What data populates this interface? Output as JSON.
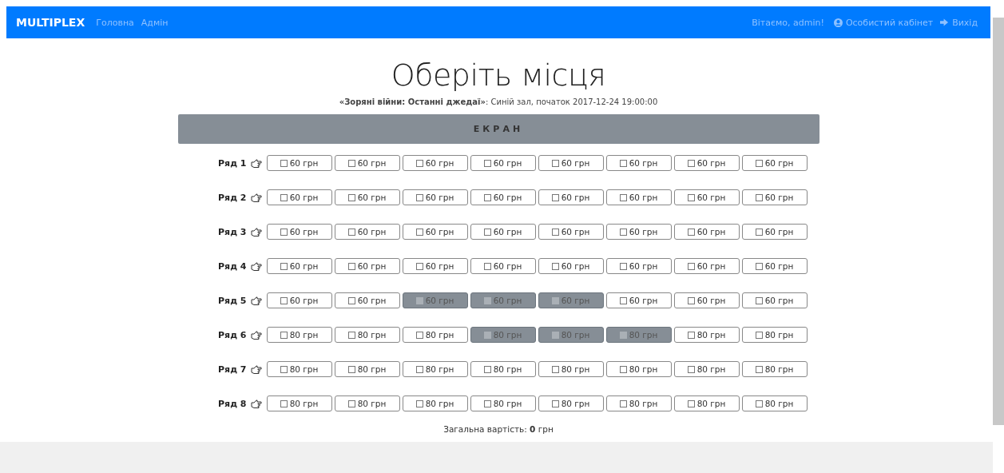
{
  "navbar": {
    "brand": "MULTIPLEX",
    "links": [
      "Головна",
      "Адмін"
    ],
    "greeting": "Вітаємо, admin!",
    "account": "Особистий кабінет",
    "logout": "Вихід"
  },
  "title": "Оберіть місця",
  "subtitle": {
    "film": "«Зоряні війни: Останні джедаї»",
    "details": ": Синій зал, початок 2017-12-24 19:00:00"
  },
  "screen": "ЕКРАН",
  "rows": [
    {
      "label": "Ряд 1",
      "seats": [
        {
          "price": "60 грн",
          "booked": false
        },
        {
          "price": "60 грн",
          "booked": false
        },
        {
          "price": "60 грн",
          "booked": false
        },
        {
          "price": "60 грн",
          "booked": false
        },
        {
          "price": "60 грн",
          "booked": false
        },
        {
          "price": "60 грн",
          "booked": false
        },
        {
          "price": "60 грн",
          "booked": false
        },
        {
          "price": "60 грн",
          "booked": false
        }
      ]
    },
    {
      "label": "Ряд 2",
      "seats": [
        {
          "price": "60 грн",
          "booked": false
        },
        {
          "price": "60 грн",
          "booked": false
        },
        {
          "price": "60 грн",
          "booked": false
        },
        {
          "price": "60 грн",
          "booked": false
        },
        {
          "price": "60 грн",
          "booked": false
        },
        {
          "price": "60 грн",
          "booked": false
        },
        {
          "price": "60 грн",
          "booked": false
        },
        {
          "price": "60 грн",
          "booked": false
        }
      ]
    },
    {
      "label": "Ряд 3",
      "seats": [
        {
          "price": "60 грн",
          "booked": false
        },
        {
          "price": "60 грн",
          "booked": false
        },
        {
          "price": "60 грн",
          "booked": false
        },
        {
          "price": "60 грн",
          "booked": false
        },
        {
          "price": "60 грн",
          "booked": false
        },
        {
          "price": "60 грн",
          "booked": false
        },
        {
          "price": "60 грн",
          "booked": false
        },
        {
          "price": "60 грн",
          "booked": false
        }
      ]
    },
    {
      "label": "Ряд 4",
      "seats": [
        {
          "price": "60 грн",
          "booked": false
        },
        {
          "price": "60 грн",
          "booked": false
        },
        {
          "price": "60 грн",
          "booked": false
        },
        {
          "price": "60 грн",
          "booked": false
        },
        {
          "price": "60 грн",
          "booked": false
        },
        {
          "price": "60 грн",
          "booked": false
        },
        {
          "price": "60 грн",
          "booked": false
        },
        {
          "price": "60 грн",
          "booked": false
        }
      ]
    },
    {
      "label": "Ряд 5",
      "seats": [
        {
          "price": "60 грн",
          "booked": false
        },
        {
          "price": "60 грн",
          "booked": false
        },
        {
          "price": "60 грн",
          "booked": true
        },
        {
          "price": "60 грн",
          "booked": true
        },
        {
          "price": "60 грн",
          "booked": true
        },
        {
          "price": "60 грн",
          "booked": false
        },
        {
          "price": "60 грн",
          "booked": false
        },
        {
          "price": "60 грн",
          "booked": false
        }
      ]
    },
    {
      "label": "Ряд 6",
      "seats": [
        {
          "price": "80 грн",
          "booked": false
        },
        {
          "price": "80 грн",
          "booked": false
        },
        {
          "price": "80 грн",
          "booked": false
        },
        {
          "price": "80 грн",
          "booked": true
        },
        {
          "price": "80 грн",
          "booked": true
        },
        {
          "price": "80 грн",
          "booked": true
        },
        {
          "price": "80 грн",
          "booked": false
        },
        {
          "price": "80 грн",
          "booked": false
        }
      ]
    },
    {
      "label": "Ряд 7",
      "seats": [
        {
          "price": "80 грн",
          "booked": false
        },
        {
          "price": "80 грн",
          "booked": false
        },
        {
          "price": "80 грн",
          "booked": false
        },
        {
          "price": "80 грн",
          "booked": false
        },
        {
          "price": "80 грн",
          "booked": false
        },
        {
          "price": "80 грн",
          "booked": false
        },
        {
          "price": "80 грн",
          "booked": false
        },
        {
          "price": "80 грн",
          "booked": false
        }
      ]
    },
    {
      "label": "Ряд 8",
      "seats": [
        {
          "price": "80 грн",
          "booked": false
        },
        {
          "price": "80 грн",
          "booked": false
        },
        {
          "price": "80 грн",
          "booked": false
        },
        {
          "price": "80 грн",
          "booked": false
        },
        {
          "price": "80 грн",
          "booked": false
        },
        {
          "price": "80 грн",
          "booked": false
        },
        {
          "price": "80 грн",
          "booked": false
        },
        {
          "price": "80 грн",
          "booked": false
        }
      ]
    }
  ],
  "total": "Загальна вартість: **0** грн"
}
